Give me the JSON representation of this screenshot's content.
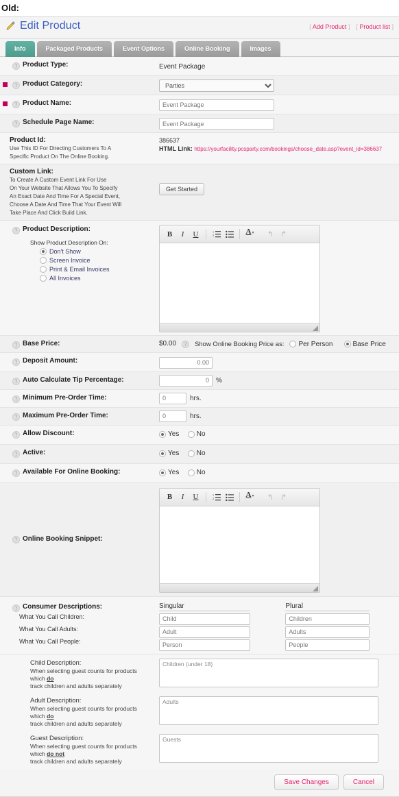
{
  "screenshot_caption": "Old:",
  "header": {
    "title": "Edit Product",
    "icon": "pencil-edit-icon",
    "links": [
      {
        "label": "Add Product"
      },
      {
        "label": "Product list"
      }
    ],
    "bracket_open": "[",
    "bracket_close": "]",
    "title_color": "#3b5ec0",
    "link_color": "#e5236e"
  },
  "tabs": [
    {
      "label": "Info",
      "active": true
    },
    {
      "label": "Packaged Products",
      "active": false
    },
    {
      "label": "Event Options",
      "active": false
    },
    {
      "label": "Online Booking",
      "active": false
    },
    {
      "label": "Images",
      "active": false
    }
  ],
  "tab_active_color": "#4d9c8c",
  "required_marker_color": "#c4005a",
  "help_icon_glyph": "?",
  "fields": {
    "product_type": {
      "label": "Product Type:",
      "value": "Event Package"
    },
    "product_category": {
      "label": "Product Category:",
      "value": "Parties",
      "required": true
    },
    "product_name": {
      "label": "Product Name:",
      "value": "Event Package",
      "required": true
    },
    "schedule_page_name": {
      "label": "Schedule Page Name:",
      "value": "Event Package"
    },
    "product_id": {
      "label": "Product Id:",
      "sub_line1": "Use This ID For Directing Customers To A",
      "sub_line2": "Specific Product On The Online Booking.",
      "value": "386637",
      "html_link_label": "HTML Link:",
      "html_link_url": "https://yourfacility.pcsparty.com/bookings/choose_date.asp?event_id=386637"
    },
    "custom_link": {
      "label": "Custom Link:",
      "lines": [
        "To Create A Custom Event Link For Use",
        "On Your Website That Allows You To Specify",
        "An Exact Date And Time For A Special Event,",
        "Choose A Date And Time That Your Event Will",
        "Take Place And Click Build Link."
      ],
      "button_label": "Get Started"
    },
    "product_description": {
      "label": "Product Description:",
      "show_on_label": "Show Product Description On:",
      "options": [
        {
          "label": "Don't Show",
          "selected": true
        },
        {
          "label": "Screen Invoice",
          "selected": false
        },
        {
          "label": "Print & Email Invoices",
          "selected": false
        },
        {
          "label": "All Invoices",
          "selected": false
        }
      ],
      "content": ""
    },
    "base_price": {
      "label": "Base Price:",
      "value": "$0.00",
      "show_as_label": "Show Online Booking Price as:",
      "options": [
        {
          "label": "Per Person",
          "selected": false
        },
        {
          "label": "Base Price",
          "selected": true
        }
      ]
    },
    "deposit_amount": {
      "label": "Deposit Amount:",
      "value": "0.00"
    },
    "tip_percentage": {
      "label": "Auto Calculate Tip Percentage:",
      "value": "0",
      "unit": "%"
    },
    "min_preorder": {
      "label": "Minimum Pre-Order Time:",
      "value": "0",
      "unit": "hrs."
    },
    "max_preorder": {
      "label": "Maximum Pre-Order Time:",
      "value": "0",
      "unit": "hrs."
    },
    "allow_discount": {
      "label": "Allow Discount:",
      "options": [
        {
          "label": "Yes",
          "selected": true
        },
        {
          "label": "No",
          "selected": false
        }
      ]
    },
    "active": {
      "label": "Active:",
      "options": [
        {
          "label": "Yes",
          "selected": true
        },
        {
          "label": "No",
          "selected": false
        }
      ]
    },
    "available_online": {
      "label": "Available For Online Booking:",
      "options": [
        {
          "label": "Yes",
          "selected": true
        },
        {
          "label": "No",
          "selected": false
        }
      ]
    },
    "online_booking_snippet": {
      "label": "Online Booking Snippet:",
      "content": ""
    },
    "consumer_descriptions": {
      "label": "Consumer Descriptions:",
      "col_singular": "Singular",
      "col_plural": "Plural",
      "rows": [
        {
          "label": "What You Call Children:",
          "singular": "Child",
          "plural": "Children"
        },
        {
          "label": "What You Call Adults:",
          "singular": "Adult",
          "plural": "Adults"
        },
        {
          "label": "What You Call People:",
          "singular": "Person",
          "plural": "People"
        }
      ]
    },
    "child_description": {
      "label": "Child Description:",
      "note_line1": "When selecting guest counts for products",
      "note_line2_pre": "which ",
      "note_line2_em": "do",
      "note_line3": "track children and adults separately",
      "value": "Children (under 18)"
    },
    "adult_description": {
      "label": "Adult Description:",
      "note_line1": "When selecting guest counts for products",
      "note_line2_pre": "which ",
      "note_line2_em": "do",
      "note_line3": "track children and adults separately",
      "value": "Adults"
    },
    "guest_description": {
      "label": "Guest Description:",
      "note_line1": "When selecting guest counts for products",
      "note_line2_pre": "which ",
      "note_line2_em": "do not",
      "note_line3": "track children and adults separately",
      "value": "Guests"
    }
  },
  "editor_toolbar": {
    "bold": "B",
    "italic": "I",
    "underline": "U",
    "ordered_list": "ordered-list-icon",
    "unordered_list": "unordered-list-icon",
    "font_color": "A",
    "font_color_caret": "▾",
    "undo": "↰",
    "redo": "↱"
  },
  "footer": {
    "save_label": "Save Changes",
    "cancel_label": "Cancel"
  }
}
